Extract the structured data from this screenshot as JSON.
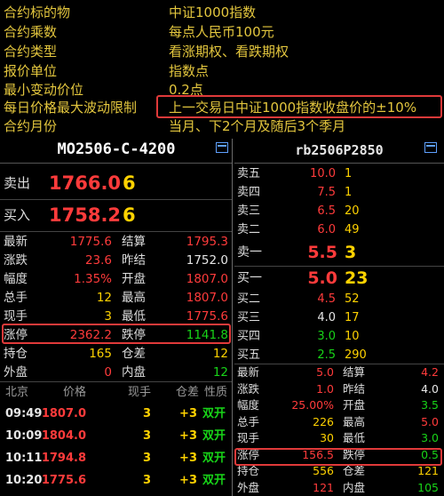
{
  "spec": {
    "rows": [
      {
        "key": "合约标的物",
        "value": "中证1000指数"
      },
      {
        "key": "合约乘数",
        "value": "每点人民币100元"
      },
      {
        "key": "合约类型",
        "value": "看涨期权、看跌期权"
      },
      {
        "key": "报价单位",
        "value": "指数点"
      },
      {
        "key": "最小变动价位",
        "value": "0.2点"
      },
      {
        "key": "每日价格最大波动限制",
        "value": "上一交易日中证1000指数收盘价的±10%"
      },
      {
        "key": "合约月份",
        "value": "当月、下2个月及随后3个季月"
      }
    ]
  },
  "left": {
    "title": "MO2506-C-4200",
    "ask": {
      "label": "卖出",
      "price": "1766.0",
      "volume": "6"
    },
    "bid": {
      "label": "买入",
      "price": "1758.2",
      "volume": "6"
    },
    "stats": [
      {
        "k1": "最新",
        "v1": "1775.6",
        "c1": "red",
        "k2": "结算",
        "v2": "1795.3",
        "c2": "red"
      },
      {
        "k1": "涨跌",
        "v1": "23.6",
        "c1": "red",
        "k2": "昨结",
        "v2": "1752.0",
        "c2": "white"
      },
      {
        "k1": "幅度",
        "v1": "1.35%",
        "c1": "red",
        "k2": "开盘",
        "v2": "1807.0",
        "c2": "red"
      },
      {
        "k1": "总手",
        "v1": "12",
        "c1": "yellow",
        "k2": "最高",
        "v2": "1807.0",
        "c2": "red"
      },
      {
        "k1": "现手",
        "v1": "3",
        "c1": "yellow",
        "k2": "最低",
        "v2": "1775.6",
        "c2": "red"
      },
      {
        "k1": "涨停",
        "v1": "2362.2",
        "c1": "red",
        "k2": "跌停",
        "v2": "1141.8",
        "c2": "green"
      },
      {
        "k1": "持仓",
        "v1": "165",
        "c1": "yellow",
        "k2": "仓差",
        "v2": "12",
        "c2": "yellow"
      },
      {
        "k1": "外盘",
        "v1": "0",
        "c1": "red",
        "k2": "内盘",
        "v2": "12",
        "c2": "green"
      }
    ],
    "ticks_header": {
      "time": "北京",
      "price": "价格",
      "vol": "现手",
      "pos": "仓差",
      "nature": "性质"
    },
    "ticks": [
      {
        "time": "09:49",
        "price": "1807.0",
        "vol": "3",
        "pos": "+3",
        "nature": "双开"
      },
      {
        "time": "10:09",
        "price": "1804.0",
        "vol": "3",
        "pos": "+3",
        "nature": "双开"
      },
      {
        "time": "10:11",
        "price": "1794.8",
        "vol": "3",
        "pos": "+3",
        "nature": "双开"
      },
      {
        "time": "10:20",
        "price": "1775.6",
        "vol": "3",
        "pos": "+3",
        "nature": "双开"
      }
    ]
  },
  "right": {
    "title": "rb2506P2850",
    "asks": [
      {
        "label": "卖五",
        "price": "10.0",
        "volume": "1"
      },
      {
        "label": "卖四",
        "price": "7.5",
        "volume": "1"
      },
      {
        "label": "卖三",
        "price": "6.5",
        "volume": "20"
      },
      {
        "label": "卖二",
        "price": "6.0",
        "volume": "49"
      }
    ],
    "best_ask": {
      "label": "卖一",
      "price": "5.5",
      "volume": "3"
    },
    "best_bid": {
      "label": "买一",
      "price": "5.0",
      "volume": "23"
    },
    "bids": [
      {
        "label": "买二",
        "price": "4.5",
        "volume": "52",
        "color": "red"
      },
      {
        "label": "买三",
        "price": "4.0",
        "volume": "17",
        "color": "white"
      },
      {
        "label": "买四",
        "price": "3.0",
        "volume": "10",
        "color": "green"
      },
      {
        "label": "买五",
        "price": "2.5",
        "volume": "290",
        "color": "green"
      }
    ],
    "stats": [
      {
        "k1": "最新",
        "v1": "5.0",
        "c1": "red",
        "k2": "结算",
        "v2": "4.2",
        "c2": "red"
      },
      {
        "k1": "涨跌",
        "v1": "1.0",
        "c1": "red",
        "k2": "昨结",
        "v2": "4.0",
        "c2": "white"
      },
      {
        "k1": "幅度",
        "v1": "25.00%",
        "c1": "red",
        "k2": "开盘",
        "v2": "3.5",
        "c2": "green"
      },
      {
        "k1": "总手",
        "v1": "226",
        "c1": "yellow",
        "k2": "最高",
        "v2": "5.0",
        "c2": "red"
      },
      {
        "k1": "现手",
        "v1": "30",
        "c1": "yellow",
        "k2": "最低",
        "v2": "3.0",
        "c2": "green"
      },
      {
        "k1": "涨停",
        "v1": "156.5",
        "c1": "red",
        "k2": "跌停",
        "v2": "0.5",
        "c2": "green"
      },
      {
        "k1": "持仓",
        "v1": "556",
        "c1": "yellow",
        "k2": "仓差",
        "v2": "121",
        "c2": "yellow"
      },
      {
        "k1": "外盘",
        "v1": "121",
        "c1": "red",
        "k2": "内盘",
        "v2": "105",
        "c2": "green"
      }
    ]
  },
  "colors": {
    "red": "#ff3b3b",
    "green": "#18d418",
    "yellow": "#ffd200",
    "highlight": "#e03a3a",
    "spec_text": "#e3c63e"
  }
}
